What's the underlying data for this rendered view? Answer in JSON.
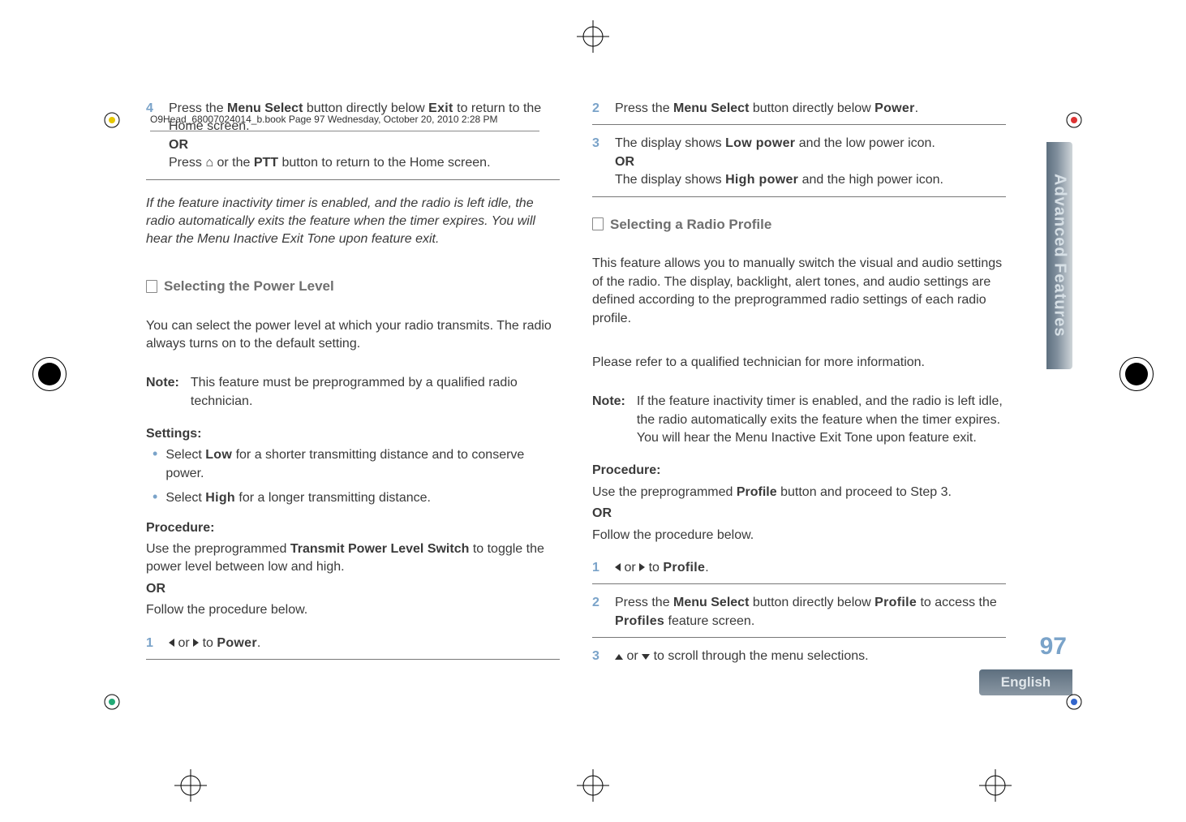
{
  "header": "O9Head_68007024014_b.book  Page 97  Wednesday, October 20, 2010  2:28 PM",
  "side_tab": "Advanced Features",
  "page_number": "97",
  "language": "English",
  "left": {
    "step4": {
      "line1_a": "Press the ",
      "line1_b": "Menu Select",
      "line1_c": " button directly below ",
      "line1_d": "Exit",
      "line1_e": " to return to the Home screen.",
      "or": "OR",
      "line2_a": "Press ",
      "line2_home": "⌂",
      "line2_b": " or the ",
      "line2_c": "PTT",
      "line2_d": " button to return to the Home screen."
    },
    "inactivity": "If the feature inactivity timer is enabled, and the radio is left idle, the radio automatically exits the feature when the timer expires. You will hear the Menu Inactive Exit Tone upon feature exit.",
    "section1_title": "Selecting the Power Level",
    "section1_intro": "You can select the power level at which your radio transmits. The radio always turns on to the default setting.",
    "note_label": "Note:",
    "note_body": "This feature must be preprogrammed by a qualified radio technician.",
    "settings_label": "Settings:",
    "bullet1_a": "Select ",
    "bullet1_b": "Low",
    "bullet1_c": " for a shorter transmitting distance and to conserve power.",
    "bullet2_a": "Select ",
    "bullet2_b": "High",
    "bullet2_c": " for a longer transmitting distance.",
    "proc_label": "Procedure:",
    "proc_body_a": "Use the preprogrammed ",
    "proc_body_b": "Transmit Power Level Switch",
    "proc_body_c": " to toggle the power level between low and high.",
    "proc_or": "OR",
    "proc_follow": "Follow the procedure below.",
    "step1_a": " or ",
    "step1_b": " to ",
    "step1_c": "Power",
    "step1_d": "."
  },
  "right": {
    "step2_a": "Press the ",
    "step2_b": "Menu Select",
    "step2_c": " button directly below ",
    "step2_d": "Power",
    "step2_e": ".",
    "step3_a": "The display shows ",
    "step3_b": "Low power",
    "step3_c": " and the low power icon.",
    "step3_or": "OR",
    "step3_d": "The display shows ",
    "step3_e": "High power",
    "step3_f": " and the high power icon.",
    "section2_title": "Selecting a Radio Profile",
    "section2_intro": "This feature allows you to manually switch the visual and audio settings of the radio. The display, backlight, alert tones, and audio settings are defined according to the preprogrammed radio settings of each radio profile.",
    "section2_ref": "Please refer to a qualified technician for more information.",
    "note_label": "Note:",
    "note_body": "If the feature inactivity timer is enabled, and the radio is left idle, the radio automatically exits the feature when the timer expires. You will hear the Menu Inactive Exit Tone upon feature exit.",
    "proc_label": "Procedure:",
    "proc_a": "Use the preprogrammed ",
    "proc_b": "Profile",
    "proc_c": " button and proceed to Step 3.",
    "proc_or": "OR",
    "proc_follow": "Follow the procedure below.",
    "rstep1_a": " or ",
    "rstep1_b": " to ",
    "rstep1_c": "Profile",
    "rstep1_d": ".",
    "rstep2_a": "Press the ",
    "rstep2_b": "Menu Select",
    "rstep2_c": " button directly below ",
    "rstep2_d": "Profile",
    "rstep2_e": " to access the ",
    "rstep2_f": "Profiles",
    "rstep2_g": " feature screen.",
    "rstep3_a": " or ",
    "rstep3_b": " to scroll through the menu selections."
  },
  "nums": {
    "n1": "1",
    "n2": "2",
    "n3": "3",
    "n4": "4"
  }
}
